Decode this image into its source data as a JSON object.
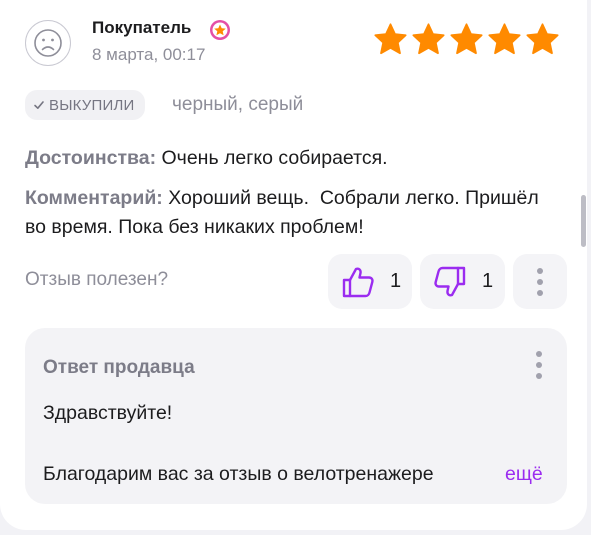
{
  "review": {
    "author": "Покупатель",
    "date": "8 марта, 00:17",
    "rating": 5,
    "purchased_label": "ВЫКУПИЛИ",
    "variant": "черный, серый",
    "pros_label": "Достоинства:",
    "pros_text": "Очень легко собирается.",
    "comment_label": "Комментарий:",
    "comment_text": "Хороший вещь.  Собрали легко. Пришёл во время. Пока без никаких проблем!"
  },
  "feedback": {
    "question": "Отзыв полезен?",
    "likes": "1",
    "dislikes": "1"
  },
  "seller_reply": {
    "title": "Ответ продавца",
    "greeting": "Здравствуйте!",
    "body": "Благодарим вас за отзыв о велотренажере",
    "more_label": "ещё"
  },
  "colors": {
    "star": "#ff8a00",
    "accent": "#9b2cf0",
    "badge": "#e44fa6"
  },
  "icons": {
    "avatar": "user-avatar-icon",
    "badge": "flower-badge-icon",
    "star": "star-icon",
    "like": "thumbs-up-icon",
    "dislike": "thumbs-down-icon",
    "menu": "more-vertical-icon",
    "check": "check-icon"
  }
}
